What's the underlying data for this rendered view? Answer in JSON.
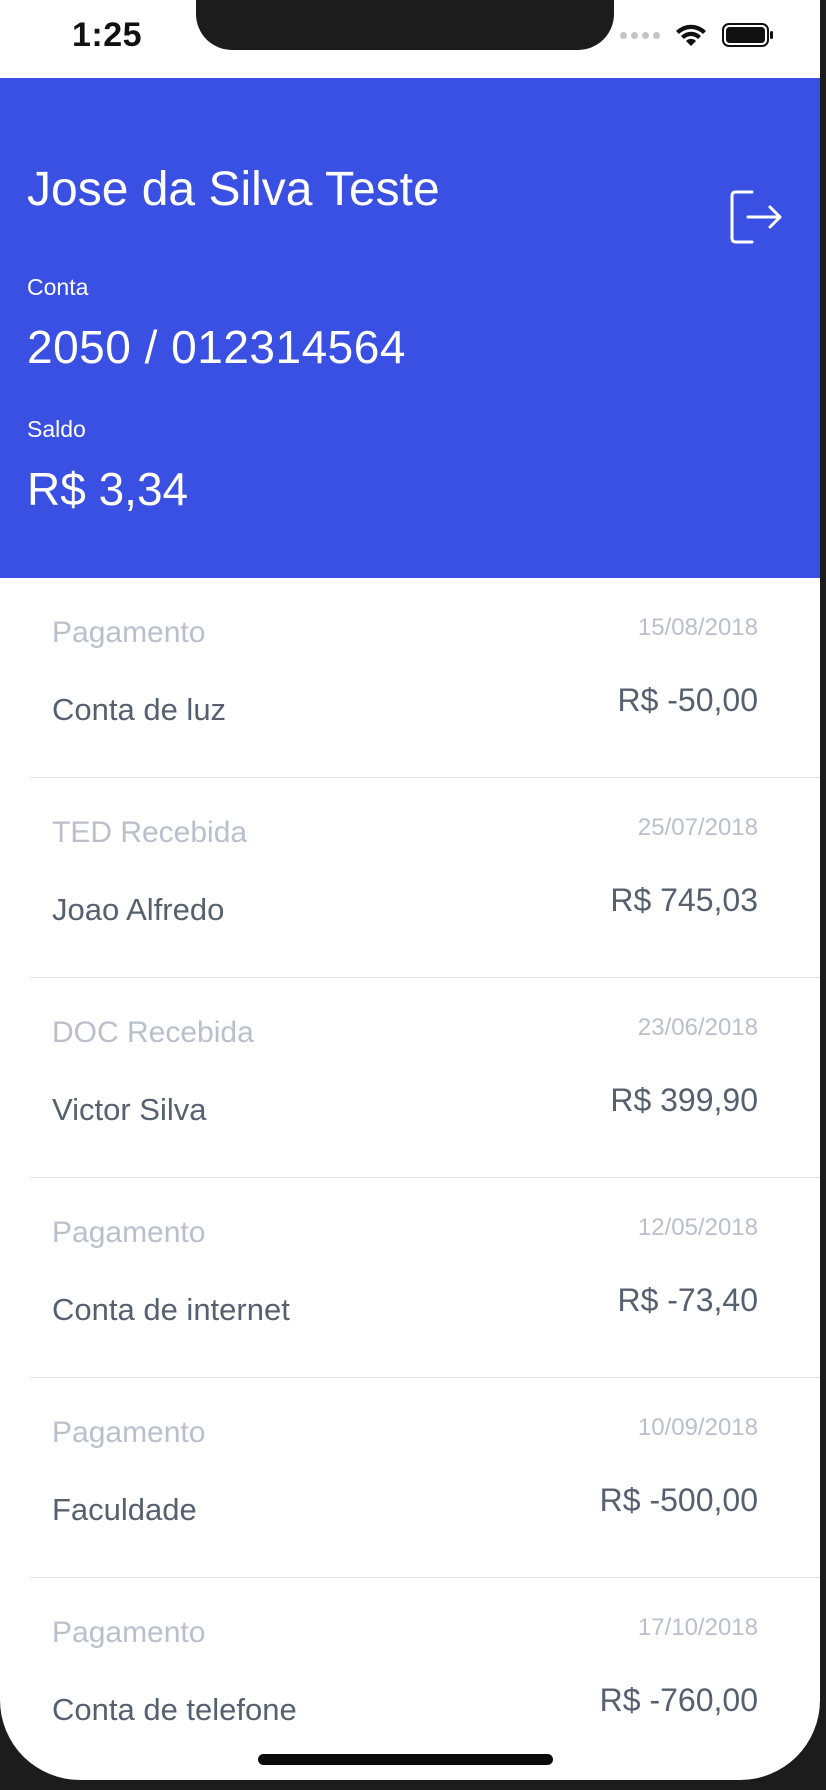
{
  "status_bar": {
    "time": "1:25"
  },
  "header": {
    "user_name": "Jose da Silva Teste",
    "account_label": "Conta",
    "account_number": "2050 / 012314564",
    "balance_label": "Saldo",
    "balance_value": "R$ 3,34",
    "background_color": "#3a50e3",
    "logout_icon": "logout-icon"
  },
  "transactions": [
    {
      "type": "Pagamento",
      "date": "15/08/2018",
      "description": "Conta de luz",
      "amount": "R$ -50,00"
    },
    {
      "type": "TED Recebida",
      "date": "25/07/2018",
      "description": "Joao Alfredo",
      "amount": "R$ 745,03"
    },
    {
      "type": "DOC Recebida",
      "date": "23/06/2018",
      "description": "Victor Silva",
      "amount": "R$ 399,90"
    },
    {
      "type": "Pagamento",
      "date": "12/05/2018",
      "description": "Conta de internet",
      "amount": "R$ -73,40"
    },
    {
      "type": "Pagamento",
      "date": "10/09/2018",
      "description": "Faculdade",
      "amount": "R$ -500,00"
    },
    {
      "type": "Pagamento",
      "date": "17/10/2018",
      "description": "Conta de telefone",
      "amount": "R$ -760,00"
    }
  ]
}
